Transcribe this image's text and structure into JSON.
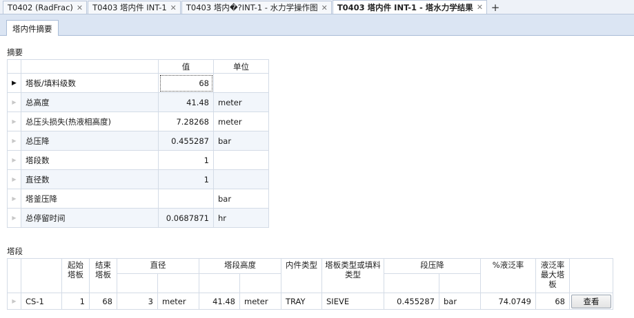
{
  "tabs": [
    {
      "label": "T0402 (RadFrac)",
      "active": false
    },
    {
      "label": "T0403 塔内件 INT-1",
      "active": false
    },
    {
      "label": "T0403 塔内�?INT-1 - 水力学操作图",
      "active": false
    },
    {
      "label": "T0403 塔内件 INT-1 - 塔水力学结果",
      "active": true
    }
  ],
  "add_tab_icon": "plus-icon",
  "sub_tab": "塔内件摘要",
  "summary": {
    "title": "摘要",
    "columns": {
      "value": "值",
      "unit": "单位"
    },
    "rows": [
      {
        "label": "塔板/填料级数",
        "value": "68",
        "unit": ""
      },
      {
        "label": "总高度",
        "value": "41.48",
        "unit": "meter"
      },
      {
        "label": "总压头损失(热液相高度)",
        "value": "7.28268",
        "unit": "meter"
      },
      {
        "label": "总压降",
        "value": "0.455287",
        "unit": "bar"
      },
      {
        "label": "塔段数",
        "value": "1",
        "unit": ""
      },
      {
        "label": "直径数",
        "value": "1",
        "unit": ""
      },
      {
        "label": "塔釜压降",
        "value": "",
        "unit": "bar"
      },
      {
        "label": "总停留时间",
        "value": "0.0687871",
        "unit": "hr"
      }
    ]
  },
  "segments": {
    "title": "塔段",
    "columns": {
      "start": "起始塔板",
      "end": "结束塔板",
      "diameter": "直径",
      "height": "塔段高度",
      "internal_type": "内件类型",
      "tray_type": "塔板类型或填料类型",
      "dp": "段压降",
      "flood": "%液泛率",
      "flood_max": "液泛率最大塔板"
    },
    "rows": [
      {
        "name": "CS-1",
        "start": "1",
        "end": "68",
        "diameter": "3",
        "diameter_unit": "meter",
        "height": "41.48",
        "height_unit": "meter",
        "internal_type": "TRAY",
        "tray_type": "SIEVE",
        "dp": "0.455287",
        "dp_unit": "bar",
        "flood": "74.0749",
        "flood_max": "68",
        "view_label": "查看"
      }
    ]
  }
}
